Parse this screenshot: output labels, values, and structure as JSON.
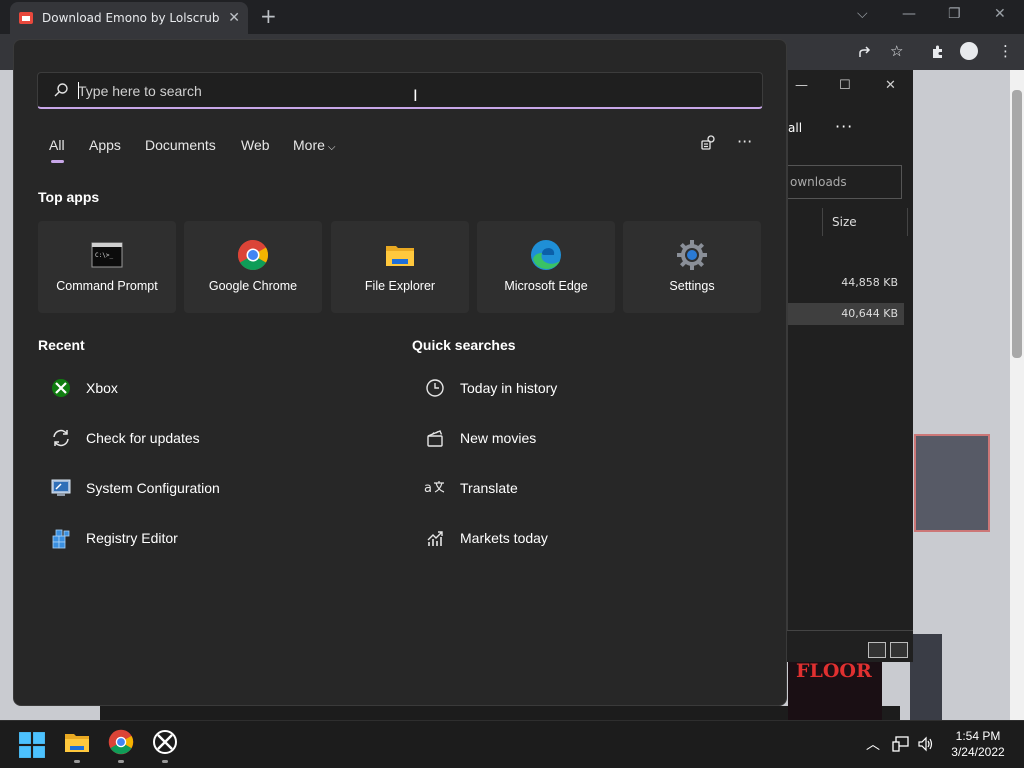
{
  "browser": {
    "tab_title": "Download Emono by Lolscrubs -",
    "tab_close_glyph": "✕",
    "new_tab_glyph": "+"
  },
  "explorer": {
    "toolbar_all": "all",
    "toolbar_more": "···",
    "search_placeholder": "ownloads",
    "size_header": "Size",
    "rows": [
      {
        "size": "44,858 KB",
        "selected": false
      },
      {
        "size": "40,644 KB",
        "selected": true
      }
    ]
  },
  "background_poster_text": "FLOOR",
  "search": {
    "placeholder": "Type here to search",
    "tabs": [
      {
        "label": "All",
        "active": true
      },
      {
        "label": "Apps"
      },
      {
        "label": "Documents"
      },
      {
        "label": "Web"
      },
      {
        "label": "More",
        "has_dropdown": true
      }
    ]
  },
  "top_apps": {
    "title": "Top apps",
    "items": [
      {
        "label": "Command Prompt",
        "icon": "command-prompt-icon"
      },
      {
        "label": "Google Chrome",
        "icon": "chrome-icon"
      },
      {
        "label": "File Explorer",
        "icon": "file-explorer-icon"
      },
      {
        "label": "Microsoft Edge",
        "icon": "edge-icon"
      },
      {
        "label": "Settings",
        "icon": "settings-gear-icon"
      }
    ]
  },
  "recent": {
    "title": "Recent",
    "items": [
      {
        "label": "Xbox",
        "icon": "xbox-icon"
      },
      {
        "label": "Check for updates",
        "icon": "refresh-icon"
      },
      {
        "label": "System Configuration",
        "icon": "system-config-icon"
      },
      {
        "label": "Registry Editor",
        "icon": "registry-icon"
      }
    ]
  },
  "quick_searches": {
    "title": "Quick searches",
    "items": [
      {
        "label": "Today in history",
        "icon": "clock-icon"
      },
      {
        "label": "New movies",
        "icon": "clapperboard-icon"
      },
      {
        "label": "Translate",
        "icon": "translate-icon"
      },
      {
        "label": "Markets today",
        "icon": "markets-chart-icon"
      }
    ]
  },
  "clock": {
    "time": "1:54 PM",
    "date": "3/24/2022"
  },
  "colors": {
    "accent": "#c8a7e9",
    "panel": "#272727",
    "tile": "#2f2f2f"
  }
}
